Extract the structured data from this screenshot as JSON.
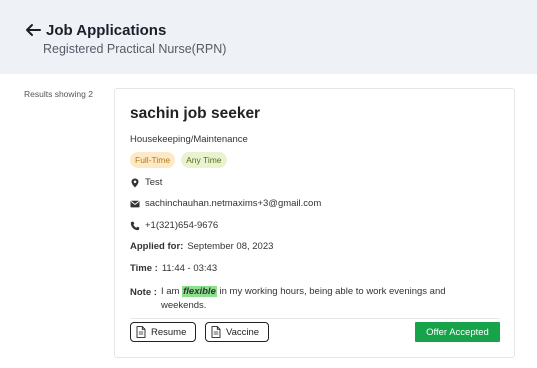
{
  "header": {
    "title": "Job Applications",
    "subtitle": "Registered Practical Nurse(RPN)"
  },
  "results_label": "Results showing 2",
  "applicant": {
    "name": "sachin job seeker",
    "category": "Housekeeping/Maintenance",
    "badges": [
      "Full-Time",
      "Any Time"
    ],
    "location": "Test",
    "email": "sachinchauhan.netmaxims+3@gmail.com",
    "phone": "+1(321)654-9676",
    "applied_for_label": "Applied for:",
    "applied_for_value": "September 08, 2023",
    "time_label": "Time :",
    "time_value": "11:44 - 03:43",
    "note_label": "Note :",
    "note_prefix": "I am ",
    "note_highlight": "flexible",
    "note_suffix": " in my working hours, being able to work evenings and weekends.",
    "documents": [
      "Resume",
      "Vaccine"
    ],
    "status": "Offer Accepted"
  },
  "colors": {
    "header_bg": "#eef1f6",
    "status_bg": "#17a34a",
    "highlight": "#8be08b"
  }
}
